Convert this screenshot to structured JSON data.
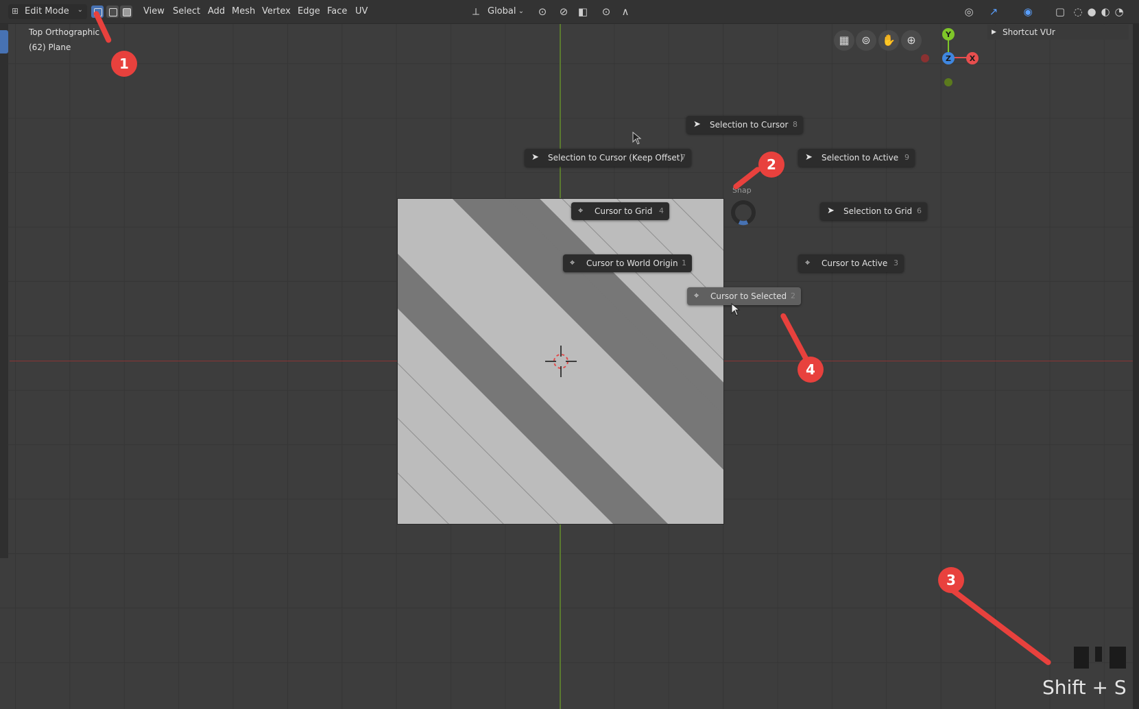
{
  "header": {
    "mode": "Edit Mode",
    "menus": [
      "View",
      "Select",
      "Add",
      "Mesh",
      "Vertex",
      "Edge",
      "Face",
      "UV"
    ],
    "transform_orientation": "Global"
  },
  "viewport": {
    "view_name": "Top Orthographic",
    "object_info": "(62) Plane"
  },
  "sidebar": {
    "panel_title": "Shortcut VUr"
  },
  "pie_menu": {
    "title": "Snap",
    "items": [
      {
        "label": "Selection to Cursor",
        "key": "8",
        "icon": "cursor-arrow-icon"
      },
      {
        "label": "Selection to Cursor (Keep Offset)",
        "key": "7",
        "icon": "cursor-arrow-icon"
      },
      {
        "label": "Selection to Active",
        "key": "9",
        "icon": "cursor-arrow-icon"
      },
      {
        "label": "Cursor to Grid",
        "key": "4",
        "icon": "3d-cursor-icon"
      },
      {
        "label": "Selection to Grid",
        "key": "6",
        "icon": "cursor-arrow-icon"
      },
      {
        "label": "Cursor to World Origin",
        "key": "1",
        "icon": "3d-cursor-icon"
      },
      {
        "label": "Cursor to Active",
        "key": "3",
        "icon": "3d-cursor-icon"
      },
      {
        "label": "Cursor to Selected",
        "key": "2",
        "icon": "3d-cursor-icon",
        "hovered": true
      }
    ]
  },
  "gizmo": {
    "y_label": "Y",
    "z_label": "Z",
    "x_label": "X",
    "colors": {
      "x": "#e84e4e",
      "y": "#7fc629",
      "z": "#3f87e0"
    }
  },
  "callouts": [
    "1",
    "2",
    "3",
    "4"
  ],
  "shortcut_overlay": {
    "text": "Shift + S"
  },
  "colors": {
    "accent": "#4772b3",
    "callout": "#e8413d"
  }
}
